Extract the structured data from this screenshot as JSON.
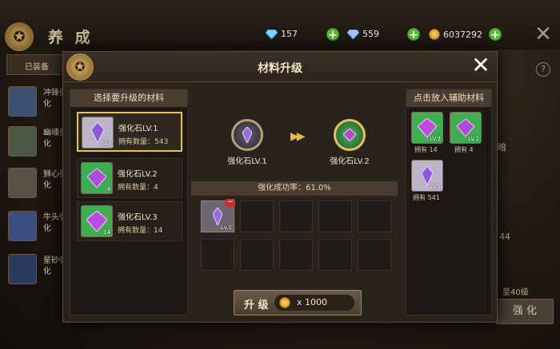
{
  "header": {
    "title": "养 成",
    "diamonds": "157",
    "crystals": "559",
    "gold": "6037292"
  },
  "sidebar": {
    "tab_label": "已装备",
    "items": [
      {
        "label": "冲锋强化"
      },
      {
        "label": "幽魂强化"
      },
      {
        "label": "狮心强化"
      },
      {
        "label": "牛头强化"
      },
      {
        "label": "星砂强化"
      }
    ]
  },
  "background": {
    "strengthen_label": "强 化",
    "frag1": "44",
    "frag2": "至40级",
    "frag3": "暗"
  },
  "modal": {
    "title": "材料升级",
    "left_header": "选择要升级的材料",
    "materials": [
      {
        "name": "强化石LV.1",
        "owned": "拥有数量：543",
        "lv": "543",
        "color": "#b9b4c8"
      },
      {
        "name": "强化石LV.2",
        "owned": "拥有数量：4",
        "lv": "4",
        "color": "#3fae52"
      },
      {
        "name": "强化石LV.3",
        "owned": "拥有数量：14",
        "lv": "14",
        "color": "#3fae52"
      }
    ],
    "from_label": "强化石LV.1",
    "to_label": "强化石LV.2",
    "success_rate": "强化成功率：61.0%",
    "slot_lv": "Lv.1",
    "upgrade_button": "升 级",
    "cost": "x 1000",
    "right_header": "点击放入辅助材料",
    "aux_items": [
      {
        "owned": "拥有 14",
        "lv": "LV.3"
      },
      {
        "owned": "拥有 4",
        "lv": "LV.2"
      },
      {
        "owned": "拥有 541",
        "lv": "LV.1"
      }
    ]
  },
  "colors": {
    "accent_gold": "#e6c25a",
    "plus_green": "#5bb83a",
    "minus_red": "#c8302a"
  }
}
